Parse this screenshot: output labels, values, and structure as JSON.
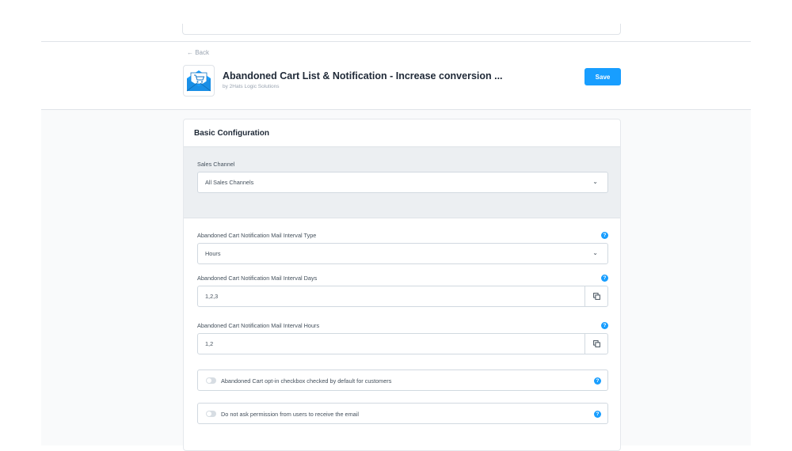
{
  "header": {
    "back_label": "← Back",
    "app_title": "Abandoned Cart List & Notification - Increase conversion ...",
    "app_vendor": "by 2Hats Logic Solutions",
    "save_label": "Save"
  },
  "colors": {
    "accent": "#189eff",
    "page_gray": "#f9fafb",
    "band_gray": "#eceff2"
  },
  "card": {
    "title": "Basic Configuration",
    "sales_channel": {
      "label": "Sales Channel",
      "value": "All Sales Channels"
    },
    "fields": {
      "interval_type": {
        "label": "Abandoned Cart Notification Mail Interval Type",
        "value": "Hours"
      },
      "interval_days": {
        "label": "Abandoned Cart Notification Mail Interval Days",
        "value": "1,2,3"
      },
      "interval_hours": {
        "label": "Abandoned Cart Notification Mail Interval Hours",
        "value": "1,2"
      }
    },
    "toggles": [
      {
        "label": "Abandoned Cart opt-in checkbox checked by default for customers",
        "checked": false
      },
      {
        "label": "Do not ask permission from users to receive the email",
        "checked": false
      }
    ],
    "help_icon": "question-icon",
    "copy_icon": "copy-icon",
    "chevron_icon": "chevron-down-icon"
  }
}
